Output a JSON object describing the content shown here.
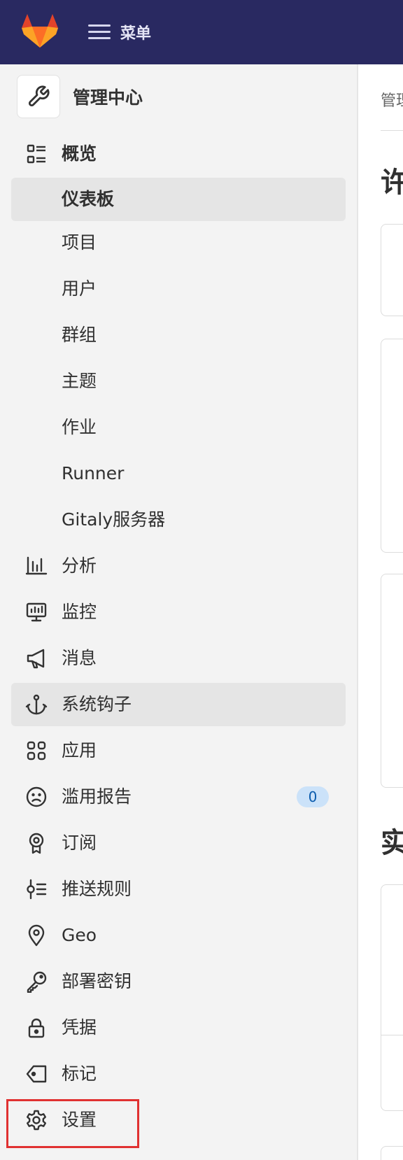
{
  "topbar": {
    "menu_label": "菜单",
    "colors": {
      "background": "#292961",
      "logo_orange": "#e2432a",
      "logo_light": "#fca326"
    }
  },
  "sidebar": {
    "context_title": "管理中心",
    "section_label": "概览",
    "items": [
      {
        "label": "仪表板",
        "icon": "none",
        "active": true
      },
      {
        "label": "项目",
        "icon": "none",
        "active": false
      },
      {
        "label": "用户",
        "icon": "none",
        "active": false
      },
      {
        "label": "群组",
        "icon": "none",
        "active": false
      },
      {
        "label": "主题",
        "icon": "none",
        "active": false
      },
      {
        "label": "作业",
        "icon": "none",
        "active": false
      },
      {
        "label": "Runner",
        "icon": "none",
        "active": false
      },
      {
        "label": "Gitaly服务器",
        "icon": "none",
        "active": false
      },
      {
        "label": "分析",
        "icon": "chart-icon",
        "active": false
      },
      {
        "label": "监控",
        "icon": "monitor-icon",
        "active": false
      },
      {
        "label": "消息",
        "icon": "megaphone-icon",
        "active": false
      },
      {
        "label": "系统钩子",
        "icon": "anchor-icon",
        "active": true
      },
      {
        "label": "应用",
        "icon": "apps-icon",
        "active": false
      },
      {
        "label": "滥用报告",
        "icon": "sad-face-icon",
        "active": false,
        "badge": "0"
      },
      {
        "label": "订阅",
        "icon": "license-icon",
        "active": false
      },
      {
        "label": "推送规则",
        "icon": "push-rules-icon",
        "active": false
      },
      {
        "label": "Geo",
        "icon": "location-icon",
        "active": false
      },
      {
        "label": "部署密钥",
        "icon": "key-icon",
        "active": false
      },
      {
        "label": "凭据",
        "icon": "lock-icon",
        "active": false
      },
      {
        "label": "标记",
        "icon": "label-icon",
        "active": false
      },
      {
        "label": "设置",
        "icon": "settings-icon",
        "active": false
      }
    ],
    "colors": {
      "active_bg": "#e5e5e5",
      "badge_bg": "#cbe2f9",
      "badge_text": "#0b5cad",
      "highlight": "#e03131"
    }
  },
  "main": {
    "breadcrumb": "管理中心",
    "heading_1": "许",
    "heading_2": "实"
  }
}
